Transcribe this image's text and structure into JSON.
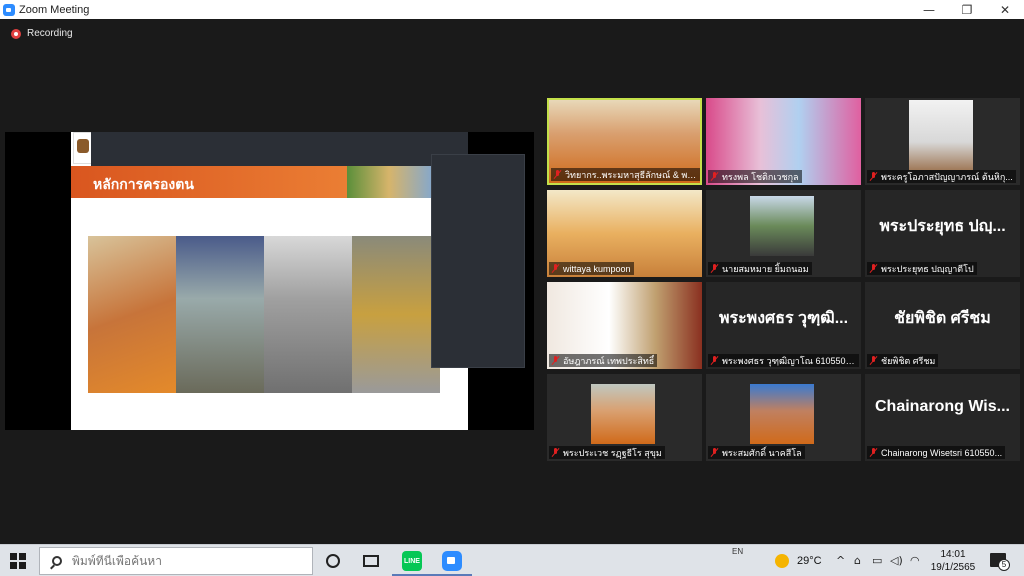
{
  "window": {
    "title": "Zoom Meeting",
    "controls": {
      "minimize": "—",
      "restore": "❐",
      "close": "✕"
    }
  },
  "recording": {
    "label": "Recording",
    "color": "#e04040"
  },
  "share": {
    "slide_title": "หลักการครองตน"
  },
  "gallery": [
    {
      "name": "วิทยากร..พระมหาสุธีลักษณ์ & พระนิ...",
      "active": true
    },
    {
      "name": "ทรงพล โชติกเวชกุล"
    },
    {
      "name": "พระครูโอภาสปัญญาภรณ์ ต้นหิกุ..."
    },
    {
      "name": "wittaya kumpoon"
    },
    {
      "name": "นายสมหมาย ยิ้มถนอม"
    },
    {
      "big": "พระประยุทธ ปญฺ...",
      "name": "พระประยุทธ ปญฺญาตีโป"
    },
    {
      "name": "อัษฎาภรณ์ เทพประสิทธิ์"
    },
    {
      "big": "พระพงศธร วุฑฺฒิ...",
      "name": "พระพงศธร วุฑฺฒิญาโณ 6105504033"
    },
    {
      "big": "ชัยพิชิต ศรีชม",
      "name": "ชัยพิชิต ศรีชม"
    },
    {
      "name": "พระประเวช รฏฺฐธีโร สุขุม"
    },
    {
      "name": "พระสมศักดิ์ นาคสีโล"
    },
    {
      "big": "Chainarong Wis...",
      "name": "Chainarong Wisetsri 610550..."
    }
  ],
  "taskbar": {
    "search_placeholder": "พิมพ์ที่นี่เพื่อค้นหา",
    "line_label": "LINE",
    "lang": "EN",
    "temperature": "29°C",
    "time": "14:01",
    "date": "19/1/2565",
    "notifications": "5",
    "tray": {
      "chevron": "^",
      "network": "⌂",
      "battery": "▭",
      "volume": "◁)",
      "wifi": "◠"
    }
  },
  "colors": {
    "active_speaker": "#c4e04a",
    "muted": "#e02020",
    "zoom_blue": "#2d8cff"
  }
}
